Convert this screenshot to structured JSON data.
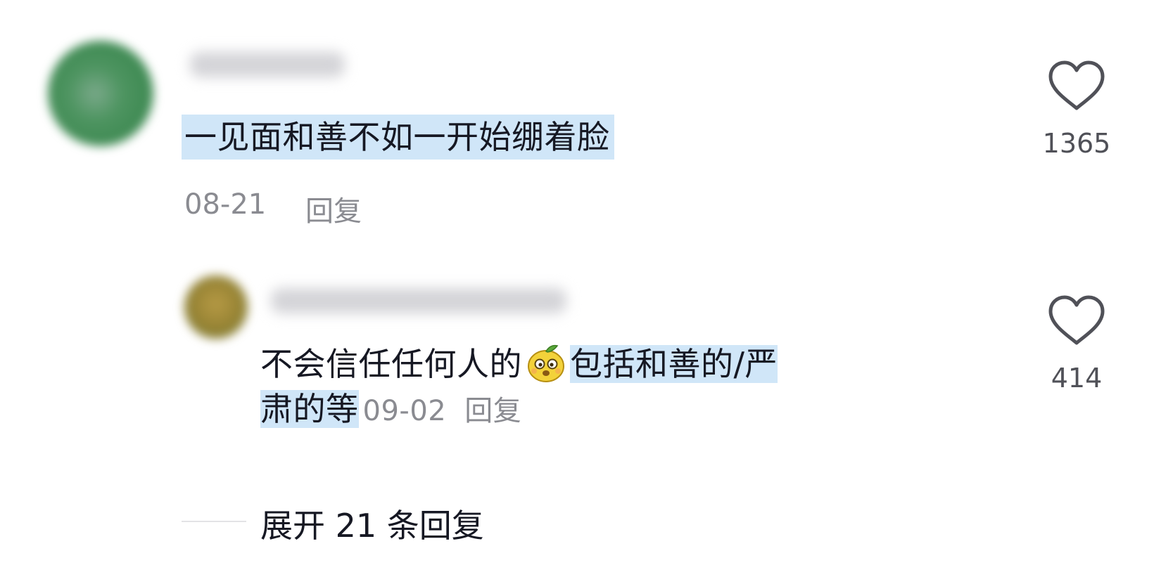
{
  "comment": {
    "text": "一见面和善不如一开始绷着脸",
    "date": "08-21",
    "reply_label": "回复",
    "like_count": "1365",
    "like_icon": "heart-outline-icon"
  },
  "reply": {
    "text_before_emoji": "不会信任任何人的",
    "emoji": "pear-face-emoji",
    "text_highlight_line1": "包括和善的/严",
    "text_highlight_line2": "肃的等",
    "date": "09-02",
    "reply_label": "回复",
    "like_count": "414",
    "like_icon": "heart-outline-icon"
  },
  "expand": {
    "label": "展开 21 条回复"
  },
  "colors": {
    "highlight": "#d0e6f8",
    "primary_text": "#161823",
    "meta_text": "#8a8b91"
  }
}
